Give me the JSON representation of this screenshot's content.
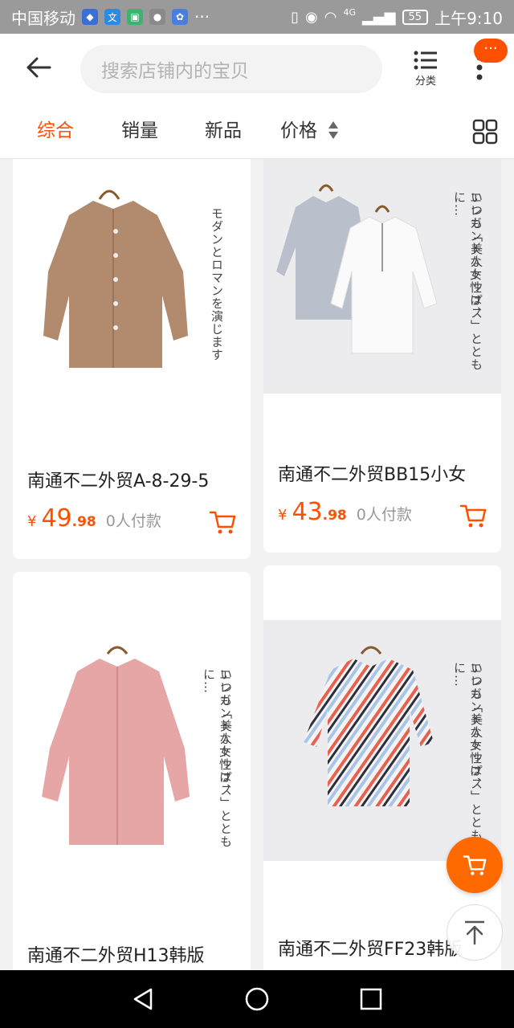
{
  "status_bar": {
    "carrier": "中国移动",
    "more": "···",
    "network": "4G",
    "battery": "55",
    "time": "上午9:10",
    "colors": {
      "shield": "#3c6fd6",
      "wen": "#2a8ae6",
      "chat": "#3cb371",
      "qq": "#cccccc",
      "baidu": "#4a7fe0"
    }
  },
  "header": {
    "search_placeholder": "搜索店铺内的宝贝",
    "category_label": "分类",
    "badge_text": "···",
    "accent": "#ff5000"
  },
  "sort_tabs": [
    {
      "label": "综合",
      "active": true
    },
    {
      "label": "销量",
      "active": false
    },
    {
      "label": "新品",
      "active": false
    },
    {
      "label": "价格",
      "active": false
    }
  ],
  "products": [
    {
      "title": "南通不二外贸A-8-29-5",
      "currency": "¥",
      "price_int": "49",
      "price_dec": ".98",
      "sold": "0人付款",
      "image": "tan-blouse-on-hanger",
      "image_text": "モダンとロマンを演じます"
    },
    {
      "title": "南通不二外贸BB15小女",
      "currency": "¥",
      "price_int": "43",
      "price_dec": ".98",
      "sold": "0人付款",
      "image": "grey-and-white-lace-up-shirts",
      "image_text_1": "エレガントな女性は、",
      "image_text_2": "いつも「美人トップス」とともに…"
    },
    {
      "title": "南通不二外贸H13韩版",
      "image": "pink-shirt-on-hanger",
      "image_text_1": "エレガントな女性は、",
      "image_text_2": "いつも「美人トップス」とともに…"
    },
    {
      "title": "南通不二外贸FF23韩版",
      "image": "striped-wrap-blouse",
      "image_text_1": "エレガントな女性は、",
      "image_text_2": "いつも「美人トップス」とともに…"
    }
  ]
}
